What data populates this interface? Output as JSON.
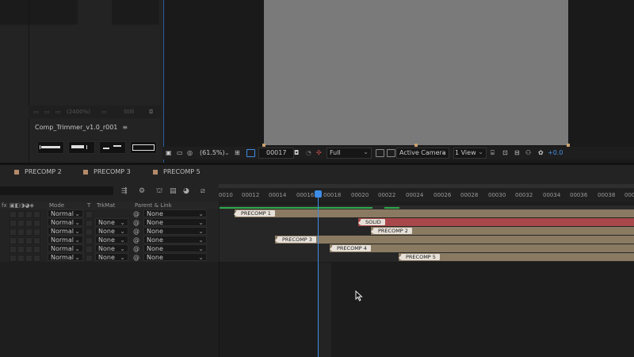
{
  "project": {
    "footer_text": "(2400%)",
    "footer_still": "Still",
    "comp_name": "Comp_Trimmer_v1.0_r001",
    "menu_glyph": "≡"
  },
  "viewer": {
    "zoom": "(61.5%)",
    "timecode": "00017",
    "resolution": "Full",
    "camera": "Active Camera",
    "views": "1 View",
    "exposure": "+0.0"
  },
  "tabs": [
    {
      "label": "PRECOMP 2"
    },
    {
      "label": "PRECOMP 3"
    },
    {
      "label": "PRECOMP 5"
    }
  ],
  "ruler": {
    "ticks": [
      "0010",
      "00012",
      "00014",
      "00016",
      "00018",
      "00020",
      "00022",
      "00024",
      "00026",
      "00028",
      "00030",
      "00032",
      "00034",
      "00036",
      "00038",
      "000"
    ]
  },
  "columns": {
    "fx": "fx",
    "mode": "Mode",
    "t": "T",
    "trkmat": "TrkMat",
    "parent": "Parent & Link"
  },
  "layers": [
    {
      "mode": "Normal",
      "trkmat": "",
      "parent": "None",
      "label": "PRECOMP 1",
      "color": "#8a7a62"
    },
    {
      "mode": "Normal",
      "trkmat": "None",
      "parent": "None",
      "label": "SOLID",
      "color": "#a8484a"
    },
    {
      "mode": "Normal",
      "trkmat": "None",
      "parent": "None",
      "label": "PRECOMP 2",
      "color": "#8a7a62"
    },
    {
      "mode": "Normal",
      "trkmat": "None",
      "parent": "None",
      "label": "PRECOMP 3",
      "color": "#8a7a62"
    },
    {
      "mode": "Normal",
      "trkmat": "None",
      "parent": "None",
      "label": "PRECOMP 4",
      "color": "#8a7a62"
    },
    {
      "mode": "Normal",
      "trkmat": "None",
      "parent": "None",
      "label": "PRECOMP 5",
      "color": "#8a7a62"
    }
  ],
  "colors": {
    "accent_blue": "#3d8ce8",
    "tab_label_swatch": "#b48a6a",
    "work_area_green": "#2fa84a"
  }
}
